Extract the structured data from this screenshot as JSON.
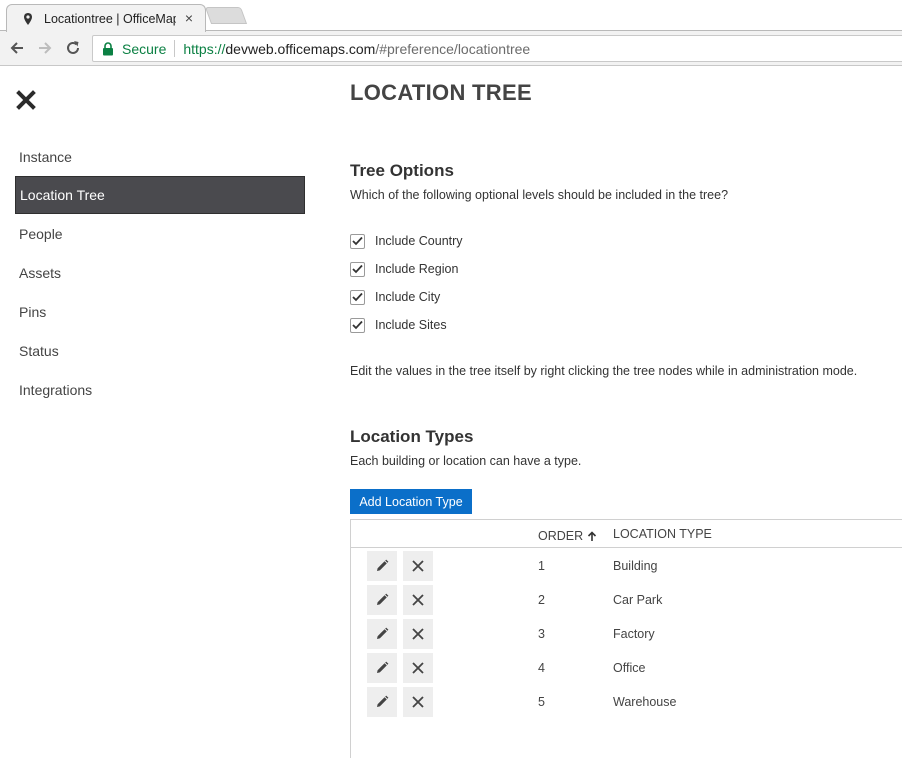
{
  "browser": {
    "tab_title": "Locationtree | OfficeMaps",
    "tab_close": "×",
    "secure_label": "Secure",
    "url_scheme": "https://",
    "url_host": "devweb.officemaps.com",
    "url_path": "/#preference/locationtree"
  },
  "sidebar": {
    "items": [
      {
        "label": "Instance"
      },
      {
        "label": "Location Tree"
      },
      {
        "label": "People"
      },
      {
        "label": "Assets"
      },
      {
        "label": "Pins"
      },
      {
        "label": "Status"
      },
      {
        "label": "Integrations"
      }
    ],
    "active_index": 1
  },
  "main": {
    "page_title": "LOCATION TREE",
    "tree_options": {
      "title": "Tree Options",
      "question": "Which of the following optional levels should be included in the tree?",
      "options": [
        {
          "label": "Include Country",
          "checked": true
        },
        {
          "label": "Include Region",
          "checked": true
        },
        {
          "label": "Include City",
          "checked": true
        },
        {
          "label": "Include Sites",
          "checked": true
        }
      ],
      "note": "Edit the values in the tree itself by right clicking the tree nodes while in administration mode."
    },
    "location_types": {
      "title": "Location Types",
      "description": "Each building or location can have a type.",
      "add_button": "Add Location Type",
      "columns": {
        "order": "ORDER",
        "type": "LOCATION TYPE"
      },
      "rows": [
        {
          "order": "1",
          "type": "Building"
        },
        {
          "order": "2",
          "type": "Car Park"
        },
        {
          "order": "3",
          "type": "Factory"
        },
        {
          "order": "4",
          "type": "Office"
        },
        {
          "order": "5",
          "type": "Warehouse"
        }
      ]
    }
  },
  "colors": {
    "accent": "#0b6fc9",
    "sidebar_active_bg": "#4a4a4e",
    "secure_green": "#0b8043"
  }
}
